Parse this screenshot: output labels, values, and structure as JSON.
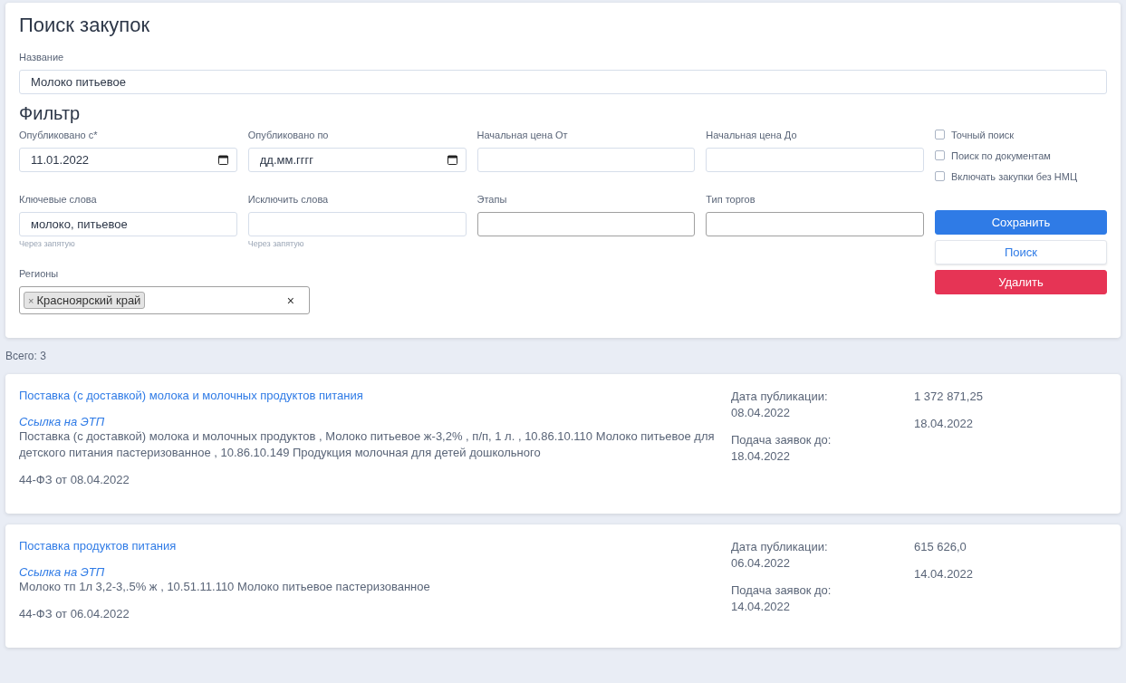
{
  "title": "Поиск закупок",
  "name_field": {
    "label": "Название",
    "value": "Молоко питьевое"
  },
  "filter": {
    "title": "Фильтр",
    "fields": [
      {
        "kind": "date",
        "label": "Опубликовано с*",
        "value": "11.01.2022"
      },
      {
        "kind": "date",
        "label": "Опубликовано по",
        "placeholder": "дд.мм.гггг"
      },
      {
        "kind": "text",
        "label": "Начальная цена От"
      },
      {
        "kind": "text",
        "label": "Начальная цена До"
      },
      {
        "kind": "text",
        "label": "Ключевые слова",
        "value": "молоко, питьевое",
        "hint": "Через запятую"
      },
      {
        "kind": "text",
        "label": "Исключить слова",
        "hint": "Через запятую"
      },
      {
        "kind": "select",
        "label": "Этапы"
      },
      {
        "kind": "select",
        "label": "Тип торгов"
      }
    ],
    "checkboxes": [
      {
        "label": "Точный поиск",
        "checked": false
      },
      {
        "label": "Поиск по документам",
        "checked": false
      },
      {
        "label": "Включать закупки без НМЦ",
        "checked": false
      }
    ],
    "buttons": [
      {
        "kind": "primary",
        "label": "Сохранить"
      },
      {
        "kind": "outline",
        "label": "Поиск"
      },
      {
        "kind": "danger",
        "label": "Удалить"
      }
    ],
    "regions": {
      "label": "Регионы",
      "tags": [
        {
          "remove": "×",
          "label": "Красноярский край"
        }
      ],
      "clear": "×"
    }
  },
  "total": "Всего: 3",
  "results": [
    {
      "title": "Поставка (с доставкой) молока и молочных продуктов питания",
      "etp_link": "Ссылка на ЭТП",
      "description": "Поставка (с доставкой) молока и молочных продуктов , Молоко питьевое ж-3,2% , п/п, 1 л. , 10.86.10.110 Молоко питьевое для детского питания пастеризованное , 10.86.10.149 Продукция молочная для детей дошкольного",
      "law": "44-ФЗ от 08.04.2022",
      "published_label": "Дата публикации:",
      "published": "08.04.2022",
      "deadline_label": "Подача заявок до:",
      "deadline": "18.04.2022",
      "price": "1 372 871,25",
      "end_date": "18.04.2022"
    },
    {
      "title": "Поставка продуктов питания",
      "etp_link": "Ссылка на ЭТП",
      "description": "Молоко тп 1л 3,2-3,.5% ж , 10.51.11.110 Молоко питьевое пастеризованное",
      "law": "44-ФЗ от 06.04.2022",
      "published_label": "Дата публикации:",
      "published": "06.04.2022",
      "deadline_label": "Подача заявок до:",
      "deadline": "14.04.2022",
      "price": "615 626,0",
      "end_date": "14.04.2022"
    }
  ]
}
